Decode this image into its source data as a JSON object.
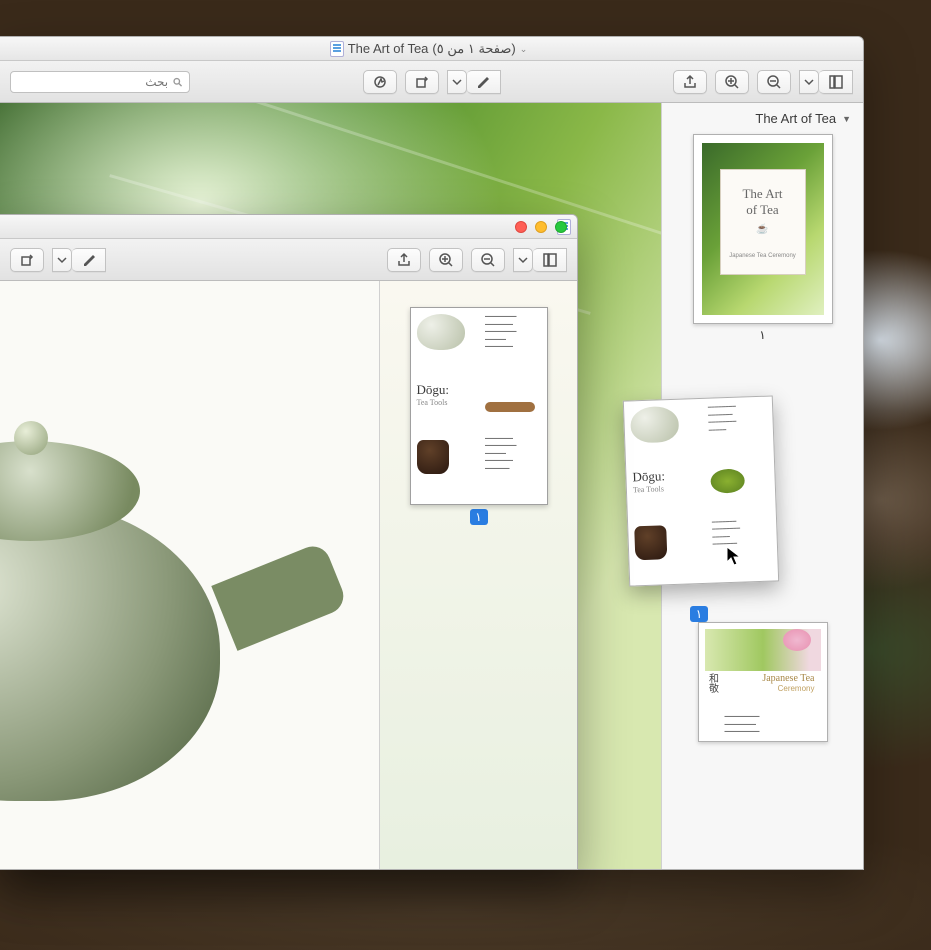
{
  "main_window": {
    "title_doc": "The Art of Tea",
    "title_page_info": "(صفحة ١ من ٥)",
    "search_placeholder": "بحث",
    "sidebar_title": "The Art of Tea",
    "cover": {
      "line1": "The Art",
      "line2": "of Tea",
      "subtitle": "Japanese Tea Ceremony"
    },
    "thumbs": {
      "p1_label": "١",
      "drag_label": "١"
    },
    "dogu": {
      "title": "Dōgu:",
      "subtitle": "Tea Tools"
    },
    "jtc": {
      "title": "Japanese Tea",
      "subtitle": "Ceremony"
    }
  },
  "front_window": {
    "dogu": {
      "title": "Dōgu:",
      "subtitle": "Tea Tools"
    },
    "p1_label": "١"
  },
  "icons": {
    "search": "search-icon",
    "markup": "markup-icon",
    "rotate": "rotate-icon",
    "pen": "pen-icon",
    "share": "share-icon",
    "zoom_in": "zoom-in-icon",
    "zoom_out": "zoom-out-icon",
    "view": "view-mode-icon"
  }
}
